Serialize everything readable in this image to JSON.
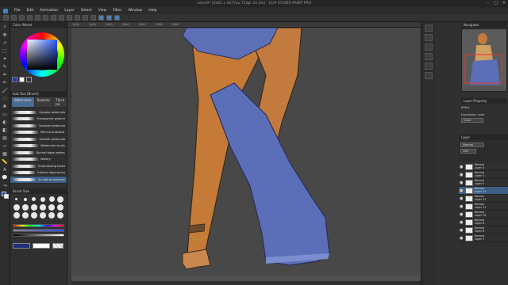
{
  "title": "notes9* (4461 x 4077px 72dpi 33.3%) - CLIP STUDIO PAINT PRO",
  "window_controls": [
    "–",
    "□",
    "✕"
  ],
  "menu": [
    "File",
    "Edit",
    "Animation",
    "Layer",
    "Select",
    "View",
    "Filter",
    "Window",
    "Help"
  ],
  "color_panel": {
    "title": "Color Wheel"
  },
  "subtool_panel": {
    "title": "Sub Tool [Brush]",
    "tabs": [
      "Watercolor",
      "Realistic",
      "Thick pa"
    ]
  },
  "brushes": [
    "Opaque watercolor",
    "Transparent watercolor",
    "Gouache watercolor",
    "Paint and absorb",
    "Smooth watercolor",
    "Watercolor brush",
    "Blurred edge watercolor",
    "Watery",
    "Emphasizing texture",
    "Intense dipping brush",
    "Sculpting watercolor"
  ],
  "selected_brush_index": 10,
  "brush_size_title": "Brush Size",
  "ruler_numbers": [
    "1000",
    "1500",
    "2000",
    "2500",
    "3000",
    "3500",
    "4000"
  ],
  "navigator_title": "Navigator",
  "layer_property": {
    "title": "Layer Property",
    "effect": "Effect",
    "expression_label": "Expression color",
    "expression_value": "Color"
  },
  "layer_panel": {
    "title": "Layer",
    "blend": "Normal",
    "opacity": "100"
  },
  "layers": [
    {
      "opacity": "100 %",
      "mode": "Normal",
      "name": "Layer 4"
    },
    {
      "opacity": "100 %",
      "mode": "Normal",
      "name": "Layer 3"
    },
    {
      "opacity": "100 %",
      "mode": "Normal",
      "name": "Layer 5"
    },
    {
      "opacity": "100 %",
      "mode": "Normal",
      "name": "Layer 13"
    },
    {
      "opacity": "100 %",
      "mode": "Normal",
      "name": "Layer 12"
    },
    {
      "opacity": "100 %",
      "mode": "Normal",
      "name": "Layer 11"
    },
    {
      "opacity": "100 %",
      "mode": "Normal",
      "name": "Layer 10"
    },
    {
      "opacity": "100 %",
      "mode": "Normal",
      "name": "Layer 6"
    },
    {
      "opacity": "100 %",
      "mode": "Normal",
      "name": "Layer 8"
    },
    {
      "opacity": "100 %",
      "mode": "Normal",
      "name": "Layer 7"
    }
  ],
  "selected_layer_index": 3,
  "colors": {
    "accent": "#3d5f84",
    "skin": "#c47a3a",
    "cloth": "#5b6fb8"
  }
}
